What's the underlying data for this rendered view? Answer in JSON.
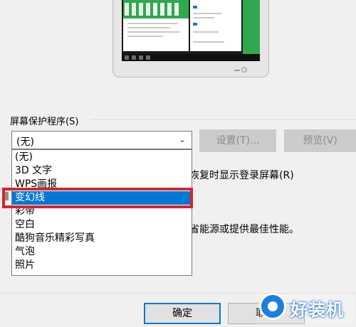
{
  "screen_saver": {
    "section_label": "屏幕保护程序(S)",
    "selected_value": "(无)",
    "settings_label": "设置(T)...",
    "preview_label": "预览(V)",
    "options": [
      "(无)",
      "3D 文字",
      "WPS画报",
      "变幻线",
      "彩带",
      "空白",
      "酷狗音乐精彩写真",
      "气泡",
      "照片"
    ],
    "highlighted_option": "变幻线"
  },
  "behind_text": {
    "resume_login": "恢复时显示登录屏幕(R)",
    "power_text": "省能源或提供最佳性能。"
  },
  "footer": {
    "ok_label": "确定",
    "cancel_label": "取"
  },
  "watermark": {
    "text": "好装机"
  },
  "colors": {
    "selection": "#0078d7",
    "highlight_border": "#d8242c",
    "screen_green": "#2fa84f"
  }
}
